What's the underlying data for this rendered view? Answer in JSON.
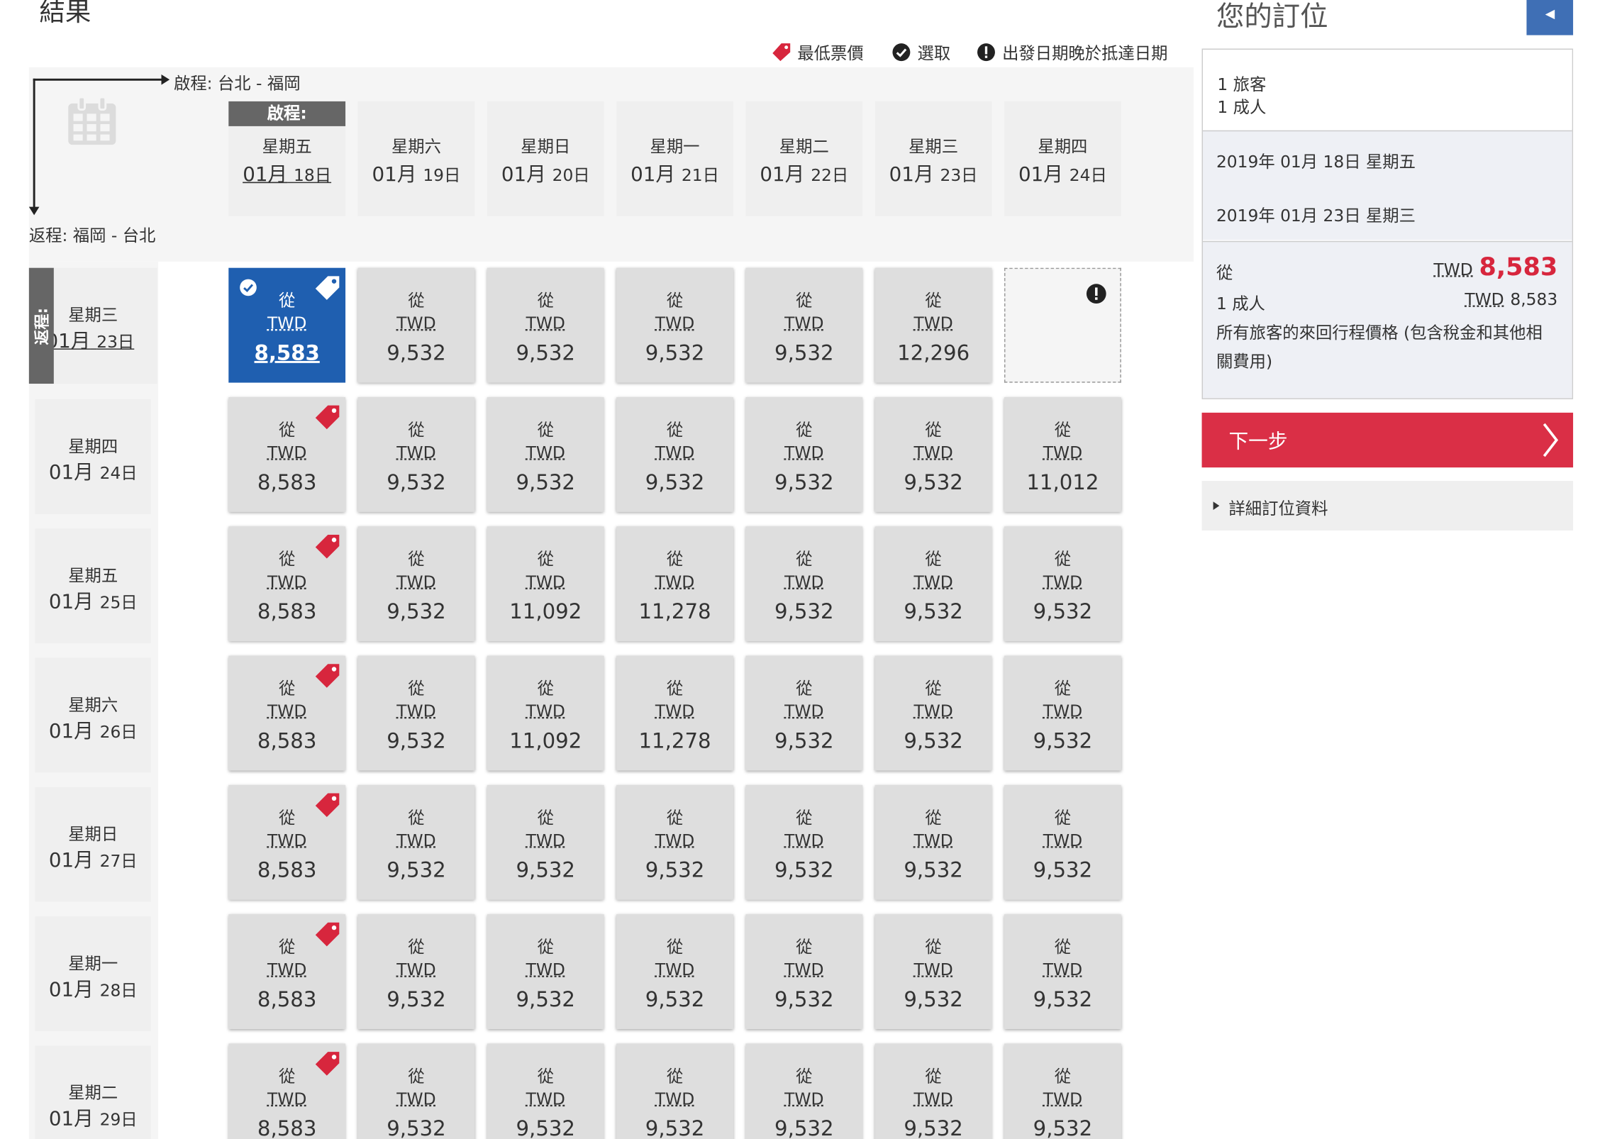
{
  "page": {
    "title": "結果"
  },
  "legend": {
    "lowest": "最低票價",
    "selected": "選取",
    "warning": "出發日期晚於抵達日期"
  },
  "matrix": {
    "outbound_label": "啟程: 台北 - 福岡",
    "return_label": "返程: 福岡 - 台北",
    "outbound_tag": "啟程:",
    "return_tag": "返程:",
    "from_label": "從",
    "currency": "TWD",
    "columns": [
      {
        "dow": "星期五",
        "month": "01月",
        "day": "18日"
      },
      {
        "dow": "星期六",
        "month": "01月",
        "day": "19日"
      },
      {
        "dow": "星期日",
        "month": "01月",
        "day": "20日"
      },
      {
        "dow": "星期一",
        "month": "01月",
        "day": "21日"
      },
      {
        "dow": "星期二",
        "month": "01月",
        "day": "22日"
      },
      {
        "dow": "星期三",
        "month": "01月",
        "day": "23日"
      },
      {
        "dow": "星期四",
        "month": "01月",
        "day": "24日"
      }
    ],
    "rows": [
      {
        "dow": "星期三",
        "month": "01月",
        "day": "23日",
        "prices": [
          "8,583",
          "9,532",
          "9,532",
          "9,532",
          "9,532",
          "12,296",
          ""
        ]
      },
      {
        "dow": "星期四",
        "month": "01月",
        "day": "24日",
        "prices": [
          "8,583",
          "9,532",
          "9,532",
          "9,532",
          "9,532",
          "9,532",
          "11,012"
        ]
      },
      {
        "dow": "星期五",
        "month": "01月",
        "day": "25日",
        "prices": [
          "8,583",
          "9,532",
          "11,092",
          "11,278",
          "9,532",
          "9,532",
          "9,532"
        ]
      },
      {
        "dow": "星期六",
        "month": "01月",
        "day": "26日",
        "prices": [
          "8,583",
          "9,532",
          "11,092",
          "11,278",
          "9,532",
          "9,532",
          "9,532"
        ]
      },
      {
        "dow": "星期日",
        "month": "01月",
        "day": "27日",
        "prices": [
          "8,583",
          "9,532",
          "9,532",
          "9,532",
          "9,532",
          "9,532",
          "9,532"
        ]
      },
      {
        "dow": "星期一",
        "month": "01月",
        "day": "28日",
        "prices": [
          "8,583",
          "9,532",
          "9,532",
          "9,532",
          "9,532",
          "9,532",
          "9,532"
        ]
      },
      {
        "dow": "星期二",
        "month": "01月",
        "day": "29日",
        "prices": [
          "8,583",
          "9,532",
          "9,532",
          "9,532",
          "9,532",
          "9,532",
          "9,532"
        ]
      }
    ]
  },
  "sidebar": {
    "title": "您的訂位",
    "travelers": "1 旅客",
    "adults": "1 成人",
    "depart_date": "2019年 01月 18日 星期五",
    "return_date": "2019年 01月 23日 星期三",
    "from": "從",
    "currency": "TWD",
    "total": "8,583",
    "adult_label": "1 成人",
    "adult_price": "8,583",
    "note_line1": "所有旅客的來回行程價格 (包含稅金和其他相",
    "note_line2": "關費用)",
    "next_button": "下一步",
    "details_link": "詳細訂位資料"
  },
  "colors": {
    "selected": "#1f5fb0",
    "lowest_tag": "#d7263d",
    "next_button": "#da2f46",
    "collapse_button": "#3f6fb5"
  }
}
